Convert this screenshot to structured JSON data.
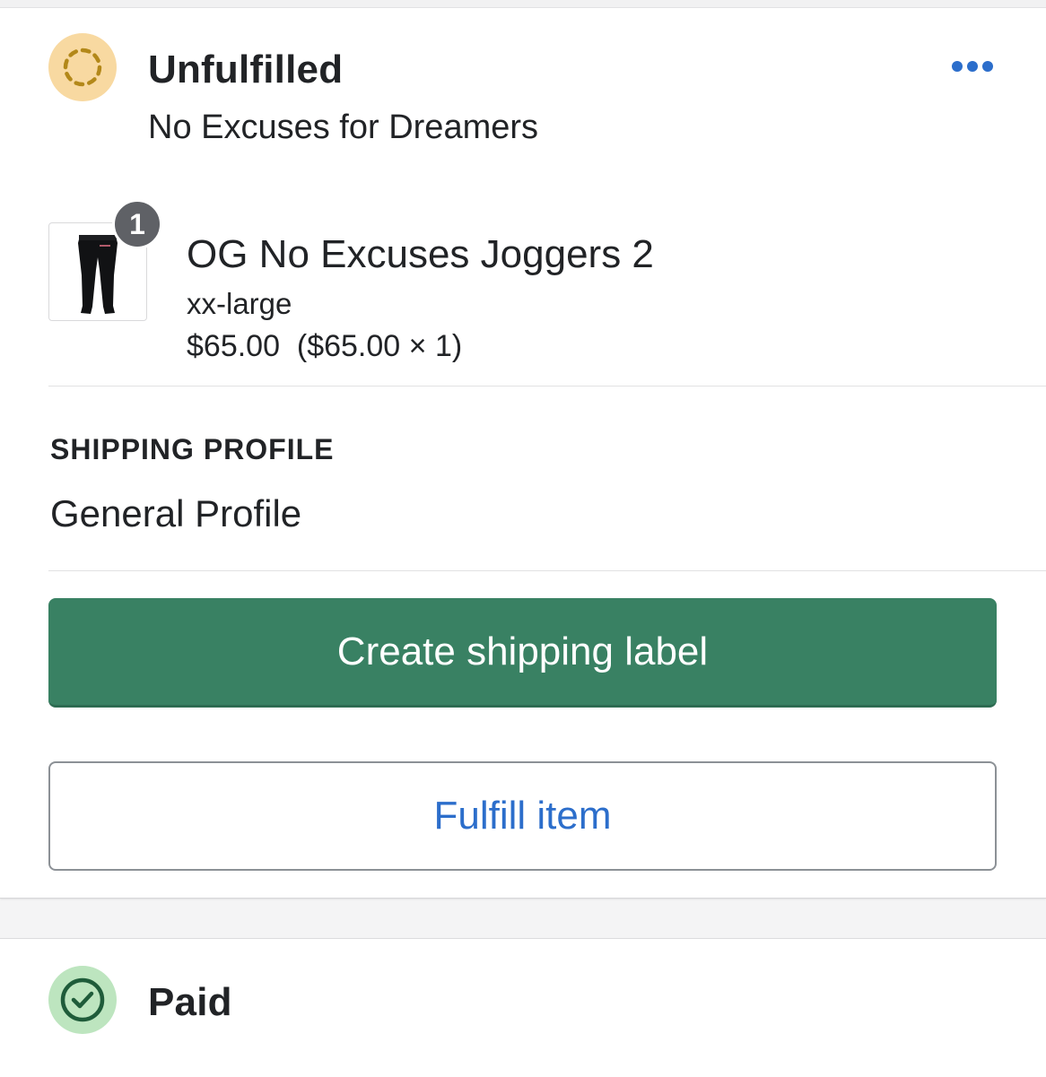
{
  "fulfillment": {
    "status": "Unfulfilled",
    "location": "No Excuses for Dreamers",
    "more_icon": "more-horizontal-icon"
  },
  "line_item": {
    "quantity_badge": "1",
    "name": "OG No Excuses Joggers 2",
    "variant": "xx-large",
    "price_line": "$65.00  ($65.00 × 1)",
    "image_icon": "joggers-product-image"
  },
  "shipping": {
    "section_label": "SHIPPING PROFILE",
    "profile_name": "General Profile"
  },
  "actions": {
    "create_label": "Create shipping label",
    "fulfill_label": "Fulfill item"
  },
  "payment": {
    "status": "Paid",
    "icon": "check-circle-icon"
  },
  "colors": {
    "primary_button": "#398163",
    "link_blue": "#2c6ecb",
    "unfulfilled_badge": "#f8d9a1",
    "paid_badge": "#bde5bf"
  }
}
